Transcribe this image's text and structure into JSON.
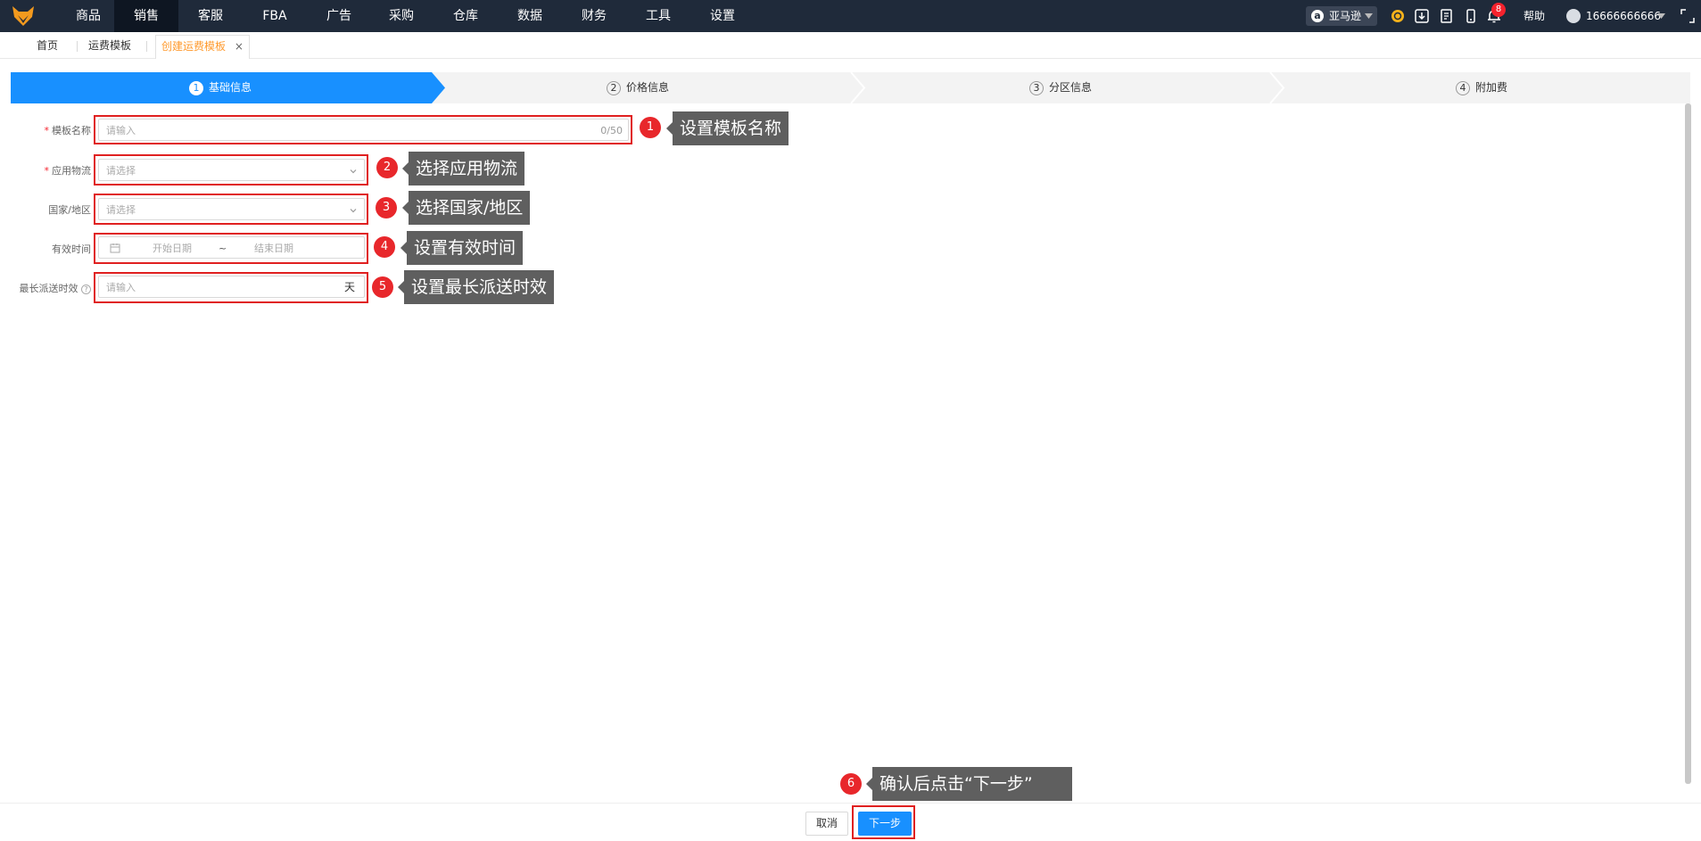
{
  "nav": {
    "items": [
      "商品",
      "销售",
      "客服",
      "FBA",
      "广告",
      "采购",
      "仓库",
      "数据",
      "财务",
      "工具",
      "设置"
    ],
    "active": "销售",
    "marketplace": "亚马逊",
    "notification_count": "8",
    "help": "帮助",
    "user": "16666666666"
  },
  "tabs": {
    "home": "首页",
    "freight_template": "运费模板",
    "create": "创建运费模板",
    "close": "×"
  },
  "steps": [
    {
      "num": "1",
      "label": "基础信息"
    },
    {
      "num": "2",
      "label": "价格信息"
    },
    {
      "num": "3",
      "label": "分区信息"
    },
    {
      "num": "4",
      "label": "附加费"
    }
  ],
  "form": {
    "template_name": {
      "label": "模板名称",
      "required": "*",
      "placeholder": "请输入",
      "counter": "0/50"
    },
    "logistics": {
      "label": "应用物流",
      "required": "*",
      "placeholder": "请选择"
    },
    "country": {
      "label": "国家/地区",
      "placeholder": "请选择"
    },
    "valid_time": {
      "label": "有效时间",
      "start": "开始日期",
      "sep": "~",
      "end": "结束日期"
    },
    "max_delivery": {
      "label": "最长派送时效",
      "placeholder": "请输入",
      "suffix": "天"
    }
  },
  "annotations": [
    {
      "num": "1",
      "text": "设置模板名称"
    },
    {
      "num": "2",
      "text": "选择应用物流"
    },
    {
      "num": "3",
      "text": "选择国家/地区"
    },
    {
      "num": "4",
      "text": "设置有效时间"
    },
    {
      "num": "5",
      "text": "设置最长派送时效"
    },
    {
      "num": "6",
      "text": "确认后点击“下一步”"
    }
  ],
  "footer": {
    "cancel": "取消",
    "next": "下一步"
  },
  "colors": {
    "nav_bg": "#1f2a3a",
    "accent": "#1890ff",
    "tab_active": "#ff9a2e",
    "annotation_red": "#e8272b",
    "callout_bg": "#5f5f5f"
  }
}
